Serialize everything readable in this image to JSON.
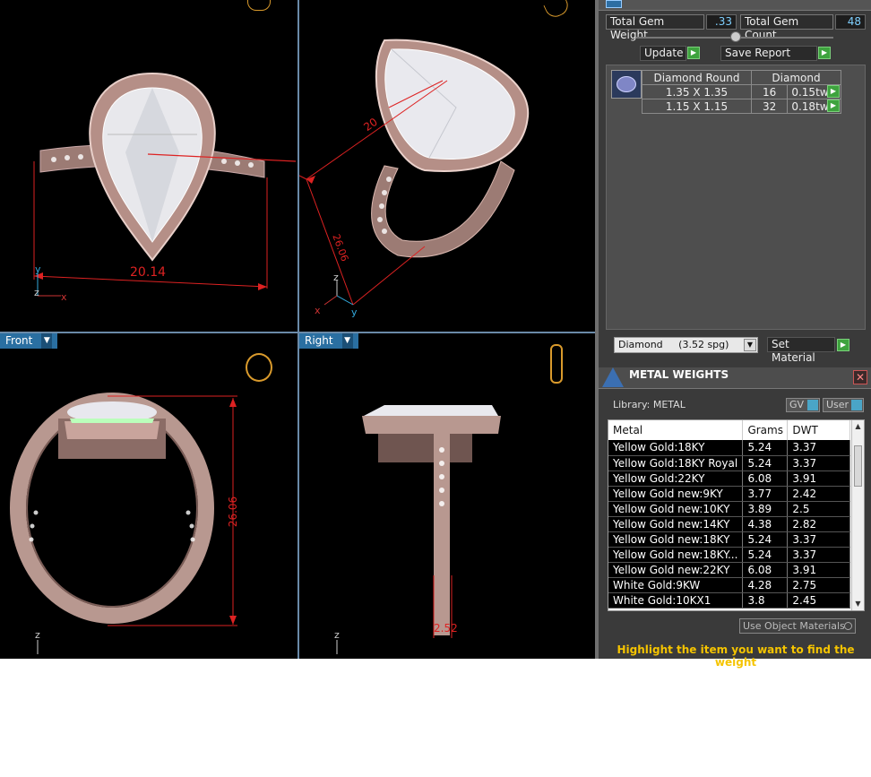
{
  "viewports": {
    "top_left": {
      "dim_width": "20.14",
      "axis_y": "y",
      "axis_z": "z",
      "axis_x": "x"
    },
    "top_right": {
      "dim_a": "20",
      "dim_b": "26.06",
      "axis_z": "z",
      "axis_x": "x",
      "axis_y": "y"
    },
    "front": {
      "label": "Front",
      "dim_height": "26.06",
      "axis_z": "z"
    },
    "right": {
      "label": "Right",
      "dim_thickness": "2.52",
      "axis_z": "z"
    }
  },
  "summary": {
    "total_gem_weight_label": "Total Gem Weight",
    "total_gem_weight_value": ".33",
    "total_gem_count_label": "Total Gem Count",
    "total_gem_count_value": "48",
    "update_label": "Update",
    "save_report_label": "Save Report"
  },
  "gem_table": {
    "headers": [
      "Diamond Round",
      "Diamond"
    ],
    "rows": [
      {
        "size": "1.35 X 1.35",
        "count": "16",
        "weight": "0.15tw"
      },
      {
        "size": "1.15 X 1.15",
        "count": "32",
        "weight": "0.18tw"
      }
    ]
  },
  "material": {
    "selected": "Diamond",
    "spg": "(3.52 spg)",
    "set_label": "Set Material"
  },
  "metal_weights": {
    "title": "METAL WEIGHTS",
    "library_label": "Library: METAL",
    "toggle_gv": "GV",
    "toggle_user": "User",
    "columns": [
      "Metal",
      "Grams",
      "DWT"
    ],
    "rows": [
      {
        "metal": "Yellow Gold:18KY",
        "grams": "5.24",
        "dwt": "3.37"
      },
      {
        "metal": "Yellow Gold:18KY Royal",
        "grams": "5.24",
        "dwt": "3.37"
      },
      {
        "metal": "Yellow Gold:22KY",
        "grams": "6.08",
        "dwt": "3.91"
      },
      {
        "metal": "Yellow Gold new:9KY",
        "grams": "3.77",
        "dwt": "2.42"
      },
      {
        "metal": "Yellow Gold new:10KY",
        "grams": "3.89",
        "dwt": "2.5"
      },
      {
        "metal": "Yellow Gold new:14KY",
        "grams": "4.38",
        "dwt": "2.82"
      },
      {
        "metal": "Yellow Gold new:18KY",
        "grams": "5.24",
        "dwt": "3.37"
      },
      {
        "metal": "Yellow Gold new:18KY...",
        "grams": "5.24",
        "dwt": "3.37"
      },
      {
        "metal": "Yellow Gold new:22KY",
        "grams": "6.08",
        "dwt": "3.91"
      },
      {
        "metal": "White Gold:9KW",
        "grams": "4.28",
        "dwt": "2.75"
      },
      {
        "metal": "White Gold:10KX1",
        "grams": "3.8",
        "dwt": "2.45"
      }
    ],
    "use_object_materials": "Use Object Materials",
    "hint": "Highlight the item you want to find the weight"
  }
}
